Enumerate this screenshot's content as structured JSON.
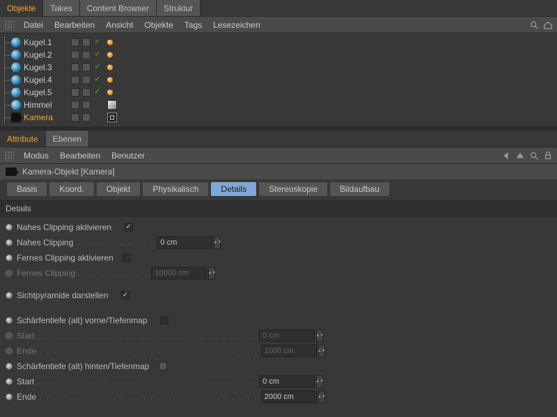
{
  "topTabs": {
    "active": "Objekte",
    "others": [
      "Takes",
      "Content Browser",
      "Struktur"
    ]
  },
  "topMenu": [
    "Datei",
    "Bearbeiten",
    "Ansicht",
    "Objekte",
    "Tags",
    "Lesezeichen"
  ],
  "tree": {
    "items": [
      {
        "name": "Kugel.1",
        "type": "sphere"
      },
      {
        "name": "Kugel.2",
        "type": "sphere"
      },
      {
        "name": "Kugel.3",
        "type": "sphere"
      },
      {
        "name": "Kugel.4",
        "type": "sphere"
      },
      {
        "name": "Kugel.5",
        "type": "sphere"
      },
      {
        "name": "Himmel",
        "type": "sky"
      },
      {
        "name": "Kamera",
        "type": "camera",
        "selected": true
      }
    ]
  },
  "attrTabs": {
    "active": "Attribute",
    "others": [
      "Ebenen"
    ]
  },
  "attrMenu": [
    "Modus",
    "Bearbeiten",
    "Benutzer"
  ],
  "attrHeader": "Kamera-Objekt [Kamera]",
  "propTabs": {
    "items": [
      "Basis",
      "Koord.",
      "Objekt",
      "Physikalisch",
      "Details",
      "Stereoskopie",
      "Bildaufbau"
    ],
    "active": "Details"
  },
  "section": "Details",
  "props": {
    "nearClipEnable": {
      "label": "Nahes Clipping aktivieren",
      "checked": true
    },
    "nearClip": {
      "label": "Nahes Clipping",
      "value": "0 cm"
    },
    "farClipEnable": {
      "label": "Fernes Clipping aktivieren",
      "checked": false
    },
    "farClip": {
      "label": "Fernes Clipping",
      "value": "10000 cm"
    },
    "frustum": {
      "label": "Sichtpyramide darstellen",
      "checked": true
    },
    "dofFront": {
      "label": "Schärfentiefe (alt) vorne/Tiefenmap",
      "checked": false
    },
    "startFront": {
      "label": "Start",
      "value": "0 cm"
    },
    "endFront": {
      "label": "Ende",
      "value": "1000 cm"
    },
    "dofBack": {
      "label": "Schärfentiefe (alt) hinten/Tiefenmap",
      "checked": true,
      "half": true
    },
    "startBack": {
      "label": "Start",
      "value": "0 cm"
    },
    "endBack": {
      "label": "Ende",
      "value": "2000 cm"
    }
  }
}
